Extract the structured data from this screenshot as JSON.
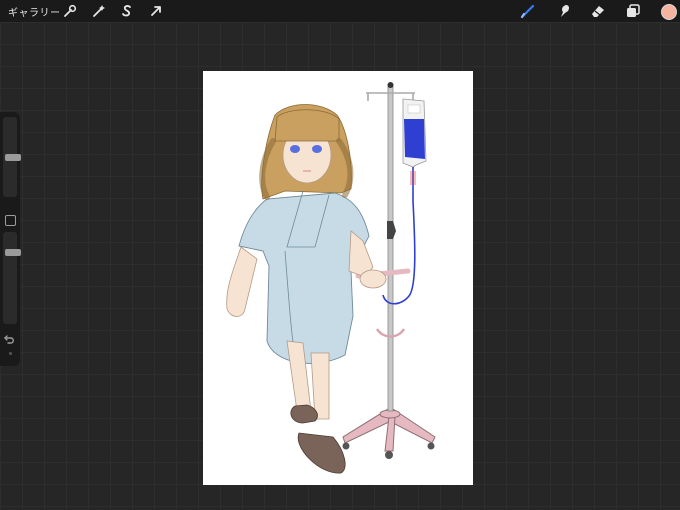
{
  "topbar": {
    "gallery_label": "ギャラリー",
    "actions_icon": "wrench-icon",
    "adjustments_icon": "magic-wand-icon",
    "selection_icon": "selection-s-icon",
    "transform_icon": "arrow-cursor-icon",
    "brush_icon": "brush-icon",
    "smudge_icon": "smudge-icon",
    "eraser_icon": "eraser-icon",
    "layers_icon": "layers-icon",
    "active_color": "#f4b4a0",
    "active_tool_color": "#3a7bf0"
  },
  "sidebar": {
    "brush_size_level": 0.5,
    "opacity_level": 0.8,
    "modify_icon": "square-icon",
    "undo_icon": "undo-icon",
    "redo_icon": "redo-icon"
  },
  "canvas": {
    "background": "#ffffff",
    "artwork": "illustration"
  },
  "colors": {
    "gown": "#c6dbe6",
    "hair": "#caa060",
    "skin": "#f7e3d2",
    "slippers": "#7a6358",
    "iv_bag_fluid": "#2e3fd1",
    "pole": "#c8c8c8",
    "base": "#e6b9c1"
  }
}
